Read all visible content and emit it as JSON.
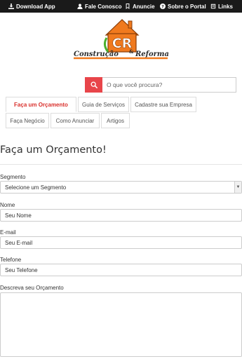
{
  "topbar": {
    "download_app": "Download App",
    "fale_conosco": "Fale Conosco",
    "anuncie": "Anuncie",
    "sobre_portal": "Sobre o Portal",
    "links": "Links"
  },
  "logo": {
    "initials": "CR",
    "name_left": "Construção",
    "name_amp": "&",
    "name_right": "Reforma"
  },
  "search": {
    "placeholder": "O que você procura?"
  },
  "nav": {
    "tabs": [
      {
        "label": "Faça um Orçamento"
      },
      {
        "label": "Guia de Serviços"
      },
      {
        "label": "Cadastre sua Empresa"
      },
      {
        "label": "Faça Negócio"
      },
      {
        "label": "Como Anunciar"
      },
      {
        "label": "Artigos"
      }
    ]
  },
  "form": {
    "title": "Faça um Orçamento!",
    "segment_label": "Segmento",
    "segment_selected": "Selecione um Segmento",
    "name_label": "Nome",
    "name_placeholder": "Seu Nome",
    "email_label": "E-mail",
    "email_placeholder": "Seu E-mail",
    "phone_label": "Telefone",
    "phone_placeholder": "Seu Telefone",
    "message_label": "Descreva seu Orçamento"
  },
  "colors": {
    "topbar": "#1a1a1a",
    "accent_red": "#e8454a",
    "logo_orange": "#f07a1e",
    "logo_green": "#4caf2e"
  }
}
